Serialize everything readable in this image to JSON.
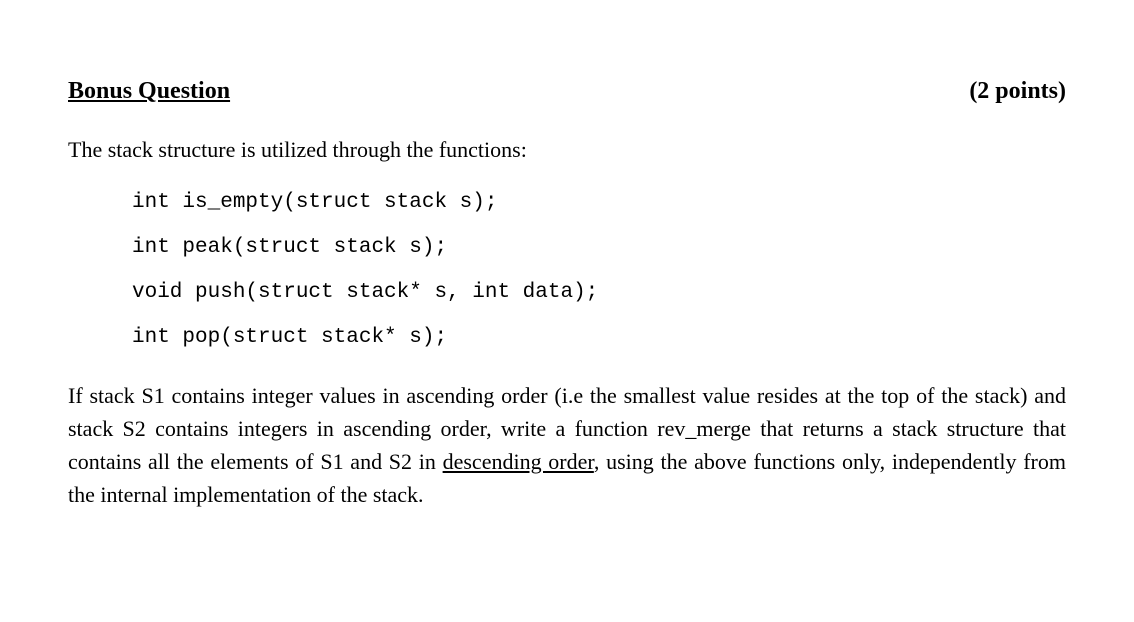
{
  "header": {
    "title": "Bonus Question",
    "points": "(2 points)"
  },
  "intro": "The stack structure is utilized through the functions:",
  "code": {
    "line1": "int is_empty(struct stack s);",
    "line2": "int peak(struct stack s);",
    "line3": "void push(struct stack* s, int data);",
    "line4": "int pop(struct stack* s);"
  },
  "paragraph": {
    "part1": "If stack S1 contains integer values in ascending order (i.e the smallest value resides at the top of the stack) and stack S2 contains integers in ascending order, write a function rev_merge that returns a stack structure that contains all the elements of S1 and S2 in ",
    "underlined": "descending order",
    "part2": ", using the above functions only, independently from the internal implementation of the stack."
  }
}
